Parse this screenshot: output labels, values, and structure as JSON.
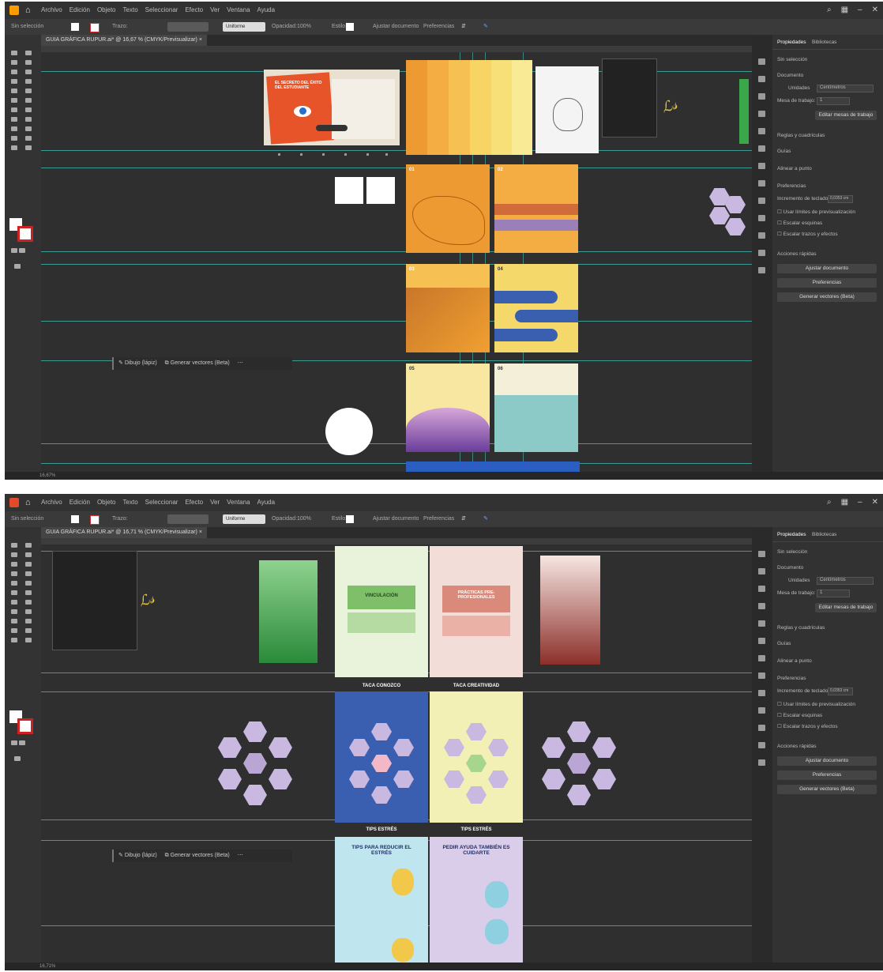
{
  "app": {
    "menu": [
      "Archivo",
      "Edición",
      "Objeto",
      "Texto",
      "Seleccionar",
      "Efecto",
      "Ver",
      "Ventana",
      "Ayuda"
    ]
  },
  "control_bar": {
    "selection": "Sin selección",
    "stroke_label": "Trazo:",
    "brush": "Uniforme",
    "opacity_label": "Opacidad:",
    "opacity_value": "100%",
    "style_label": "Estilo:",
    "doc_settings": "Ajustar documento",
    "preferences": "Preferencias"
  },
  "screenshot1": {
    "tab_title": "GUIA GRÁFICA RUPUR.ai* @ 16,67 % (CMYK/Previsualizar)",
    "context_bar": {
      "draw": "Dibujo (lápiz)",
      "vectorize": "Generar vectores (Beta)"
    },
    "zoom": "16,67%",
    "page_numbers": [
      "01",
      "02",
      "03",
      "04",
      "05",
      "06"
    ],
    "poster_title": "EL SECRETO DEL ÉXITO DEL ESTUDIANTE"
  },
  "screenshot2": {
    "tab_title": "GUIA GRÁFICA RUPUR.ai* @ 16,71 % (CMYK/Previsualizar)",
    "context_bar": {
      "draw": "Dibujo (lápiz)",
      "vectorize": "Generar vectores (Beta)"
    },
    "zoom": "16,71%",
    "labels": {
      "vinculacion": "VINCULACIÓN",
      "practicas": "PRÁCTICAS PRE-PROFESIONALES",
      "taca_conozco": "TACA CONOZCO",
      "taca_creatividad": "TACA CREATIVIDAD",
      "tips_estres": "TIPS ESTRÉS",
      "tips_reducir": "TIPS PARA REDUCIR EL ESTRÉS",
      "pedir_ayuda": "PEDIR AYUDA TAMBIÉN ES CUIDARTE"
    }
  },
  "panel": {
    "tabs": [
      "Propiedades",
      "Bibliotecas"
    ],
    "no_selection": "Sin selección",
    "document": "Documento",
    "units_label": "Unidades",
    "units_value": "Centímetros",
    "artboard_label": "Mesa de trabajo:",
    "artboard_value": "1",
    "edit_artboards": "Editar mesas de trabajo",
    "rulers": "Reglas y cuadrículas",
    "guides": "Guías",
    "align": "Alinear a punto",
    "preferences_hdr": "Preferencias",
    "keyboard_inc": "Incremento de teclado",
    "keyboard_value": "0,0353 cm",
    "opt1": "Usar límites de previsualización",
    "opt2": "Escalar esquinas",
    "opt3": "Escalar trazos y efectos",
    "quick_actions": "Acciones rápidas",
    "btn1": "Ajustar documento",
    "btn2": "Preferencias",
    "btn3": "Generar vectores (Beta)"
  },
  "colors": {
    "app_bg": "#2b2b2b",
    "guide": "#3fa7a0",
    "orange": "#f0a030",
    "yellow": "#f4d86a",
    "blue": "#3b5fb0",
    "lavender": "#c9b8e0",
    "green": "#3aa84a",
    "maroon": "#8c2f2a"
  }
}
